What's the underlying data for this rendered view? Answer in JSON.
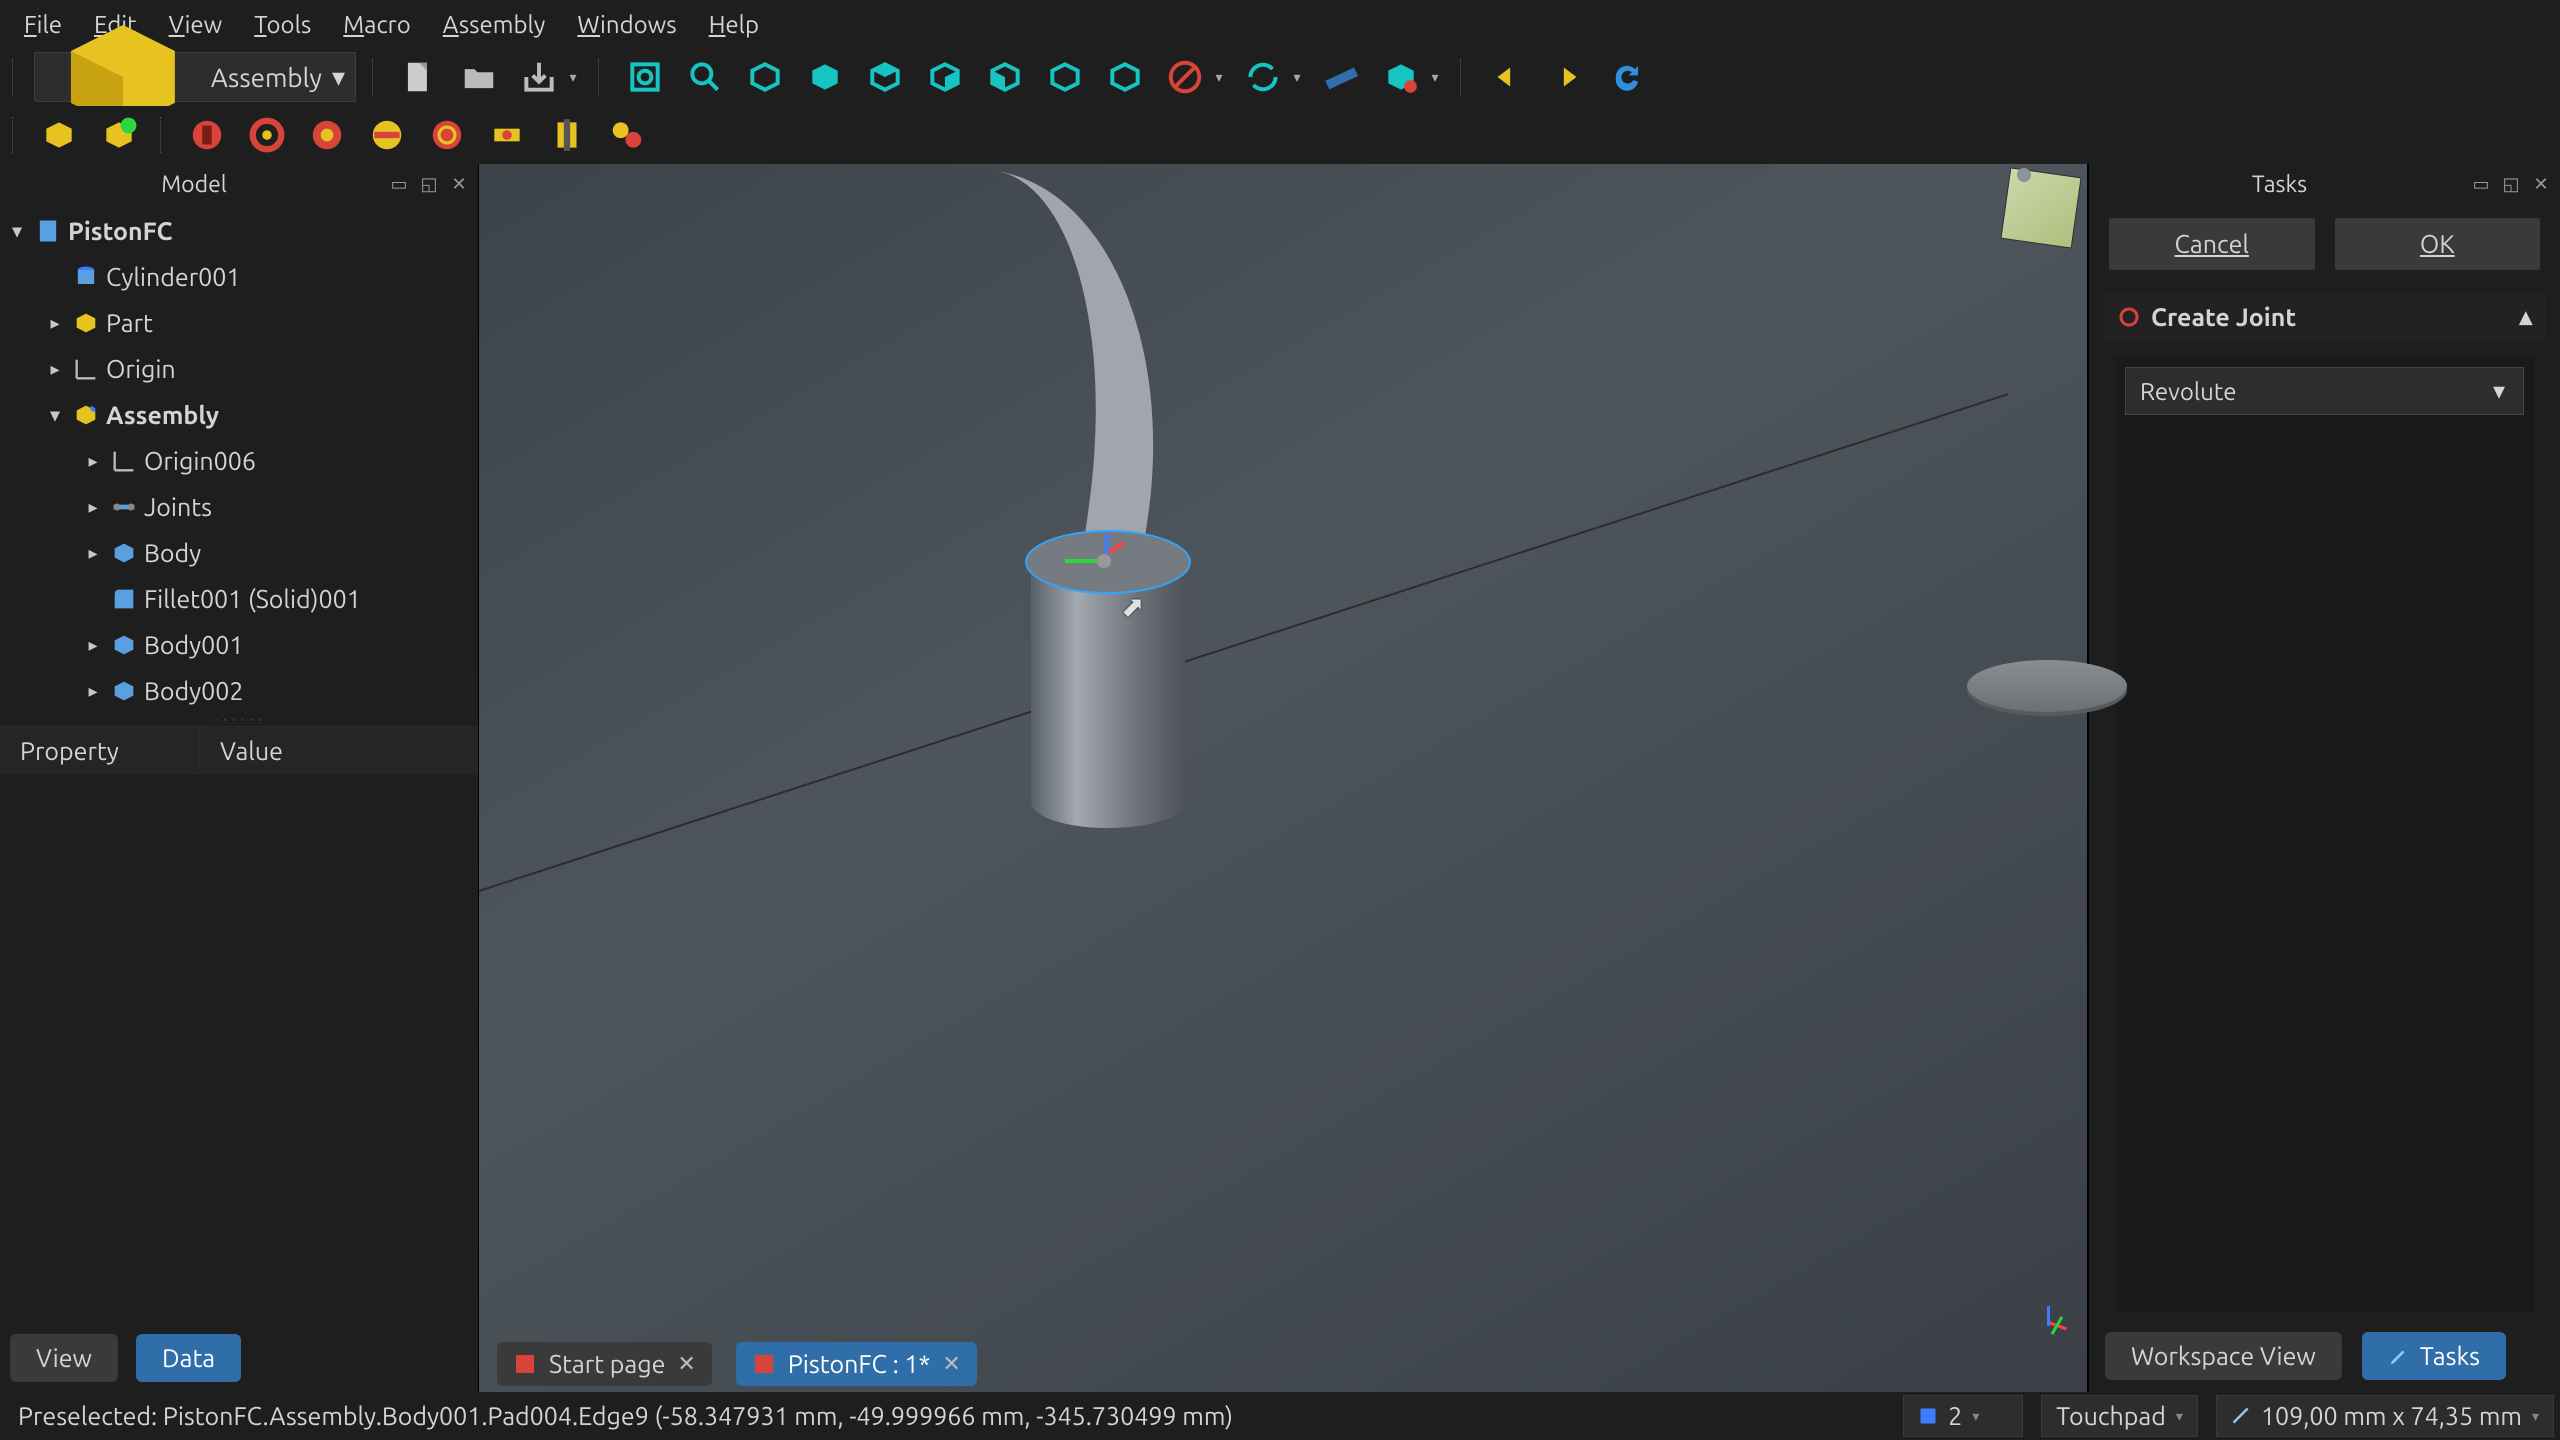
{
  "menu": [
    "File",
    "Edit",
    "View",
    "Tools",
    "Macro",
    "Assembly",
    "Windows",
    "Help"
  ],
  "workbench": "Assembly",
  "model_panel_title": "Model",
  "tasks_panel_title": "Tasks",
  "tree": {
    "root": "PistonFC",
    "children": [
      {
        "icon": "cyl",
        "label": "Cylinder001"
      },
      {
        "icon": "part",
        "label": "Part",
        "caret": true
      },
      {
        "icon": "origin",
        "label": "Origin",
        "caret": true
      },
      {
        "icon": "asm",
        "label": "Assembly",
        "caret": true,
        "open": true,
        "bold": true,
        "children": [
          {
            "icon": "origin",
            "label": "Origin006",
            "caret": true
          },
          {
            "icon": "joints",
            "label": "Joints",
            "caret": true
          },
          {
            "icon": "body",
            "label": "Body",
            "caret": true
          },
          {
            "icon": "fillet",
            "label": "Fillet001 (Solid)001"
          },
          {
            "icon": "body",
            "label": "Body001",
            "caret": true
          },
          {
            "icon": "body",
            "label": "Body002",
            "caret": true
          }
        ]
      }
    ]
  },
  "property_headers": [
    "Property",
    "Value"
  ],
  "left_tabs": [
    "View",
    "Data"
  ],
  "left_active_tab": 1,
  "viewport_tabs": [
    "Start page",
    "PistonFC : 1*"
  ],
  "viewport_active_tab": 1,
  "right": {
    "cancel": "Cancel",
    "ok": "OK",
    "section_title": "Create Joint",
    "joint_type": "Revolute"
  },
  "right_footer": [
    "Workspace View",
    "Tasks"
  ],
  "right_footer_active": 1,
  "status": {
    "text": "Preselected: PistonFC.Assembly.Body001.Pad004.Edge9 (-58.347931 mm, -49.999966 mm, -345.730499 mm)",
    "slot1": "2",
    "slot2": "Touchpad",
    "slot3": "109,00 mm x 74,35 mm"
  }
}
